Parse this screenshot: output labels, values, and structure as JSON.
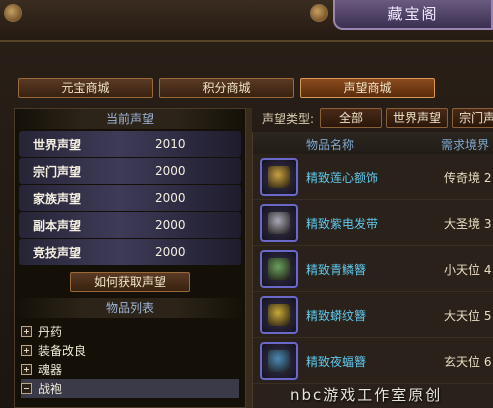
{
  "window": {
    "title": "藏宝阁"
  },
  "shop_tabs": [
    {
      "label": "元宝商城",
      "active": false
    },
    {
      "label": "积分商城",
      "active": false
    },
    {
      "label": "声望商城",
      "active": true
    }
  ],
  "current_reputation": {
    "header": "当前声望",
    "items": [
      {
        "name": "世界声望",
        "value": "2010"
      },
      {
        "name": "宗门声望",
        "value": "2000"
      },
      {
        "name": "家族声望",
        "value": "2000"
      },
      {
        "name": "副本声望",
        "value": "2000"
      },
      {
        "name": "竞技声望",
        "value": "2000"
      }
    ],
    "how_to_button": "如何获取声望"
  },
  "item_categories": {
    "header": "物品列表",
    "items": [
      {
        "label": "丹药",
        "expanded": false
      },
      {
        "label": "装备改良",
        "expanded": false
      },
      {
        "label": "魂器",
        "expanded": false
      },
      {
        "label": "战袍",
        "expanded": true,
        "selected": true
      }
    ]
  },
  "filter": {
    "label": "声望类型:",
    "options": [
      "全部",
      "世界声望",
      "宗门声"
    ]
  },
  "table": {
    "columns": [
      "物品名称",
      "需求境界"
    ],
    "rows": [
      {
        "name": "精致莲心额饰",
        "requirement": "传奇境 2",
        "icon": "headband-icon",
        "color": "#c9a040"
      },
      {
        "name": "精致紫电发带",
        "requirement": "大圣境 3",
        "icon": "hairband-icon",
        "color": "#a8a8b8"
      },
      {
        "name": "精致青鳞簪",
        "requirement": "小天位 4",
        "icon": "hairpin-icon",
        "color": "#6aa060"
      },
      {
        "name": "精致蟒纹簪",
        "requirement": "大天位 5",
        "icon": "hairpin-icon",
        "color": "#c8a838"
      },
      {
        "name": "精致夜蝠簪",
        "requirement": "玄天位 6",
        "icon": "hairpin-icon",
        "color": "#4a8ab8"
      }
    ]
  },
  "watermark": "nbc游戏工作室原创"
}
